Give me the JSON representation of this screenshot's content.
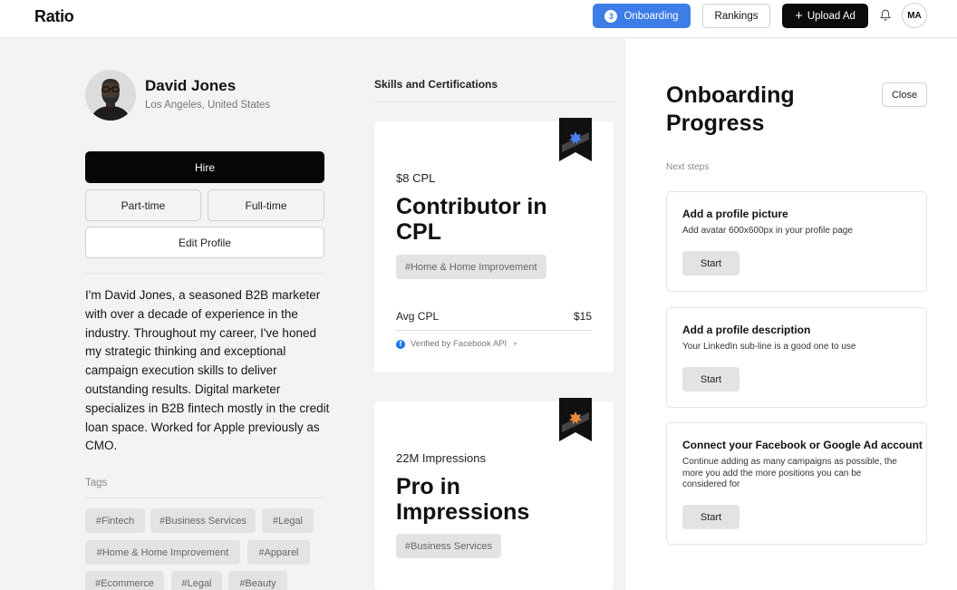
{
  "header": {
    "logo": "Ratio",
    "onboarding": {
      "count": "3",
      "label": "Onboarding"
    },
    "rankings_label": "Rankings",
    "upload_label": "Upload Ad",
    "user_initials": "MA"
  },
  "profile": {
    "name": "David Jones",
    "location": "Los Angeles, United States",
    "hire_label": "Hire",
    "part_time_label": "Part-time",
    "full_time_label": "Full-time",
    "edit_label": "Edit Profile",
    "bio": "I'm David Jones, a seasoned B2B marketer with over a decade of experience in the industry. Throughout my career, I've honed my strategic thinking and exceptional campaign execution skills to deliver outstanding results. Digital marketer specializes in B2B fintech mostly in the credit loan space. Worked for Apple previously as CMO.",
    "tags_label": "Tags",
    "tags": [
      "#Fintech",
      "#Business Services",
      "#Legal",
      "#Home & Home Improvement",
      "#Apparel",
      "#Ecommerce",
      "#Legal",
      "#Beauty"
    ]
  },
  "skills": {
    "title": "Skills and Certifications",
    "cards": [
      {
        "metric": "$8 CPL",
        "title_line1": "Contributor in",
        "title_line2": "CPL",
        "tag": "#Home & Home Improvement",
        "avg_label": "Avg CPL",
        "avg_value": "$15",
        "verified": "Verified by Facebook API",
        "ribbon_color": "#4a7ff0"
      },
      {
        "metric": "22M Impressions",
        "title_line1": "Pro in",
        "title_line2": "Impressions",
        "tag": "#Business Services",
        "ribbon_color": "#e8893a"
      }
    ]
  },
  "onboarding_panel": {
    "title_line1": "Onboarding",
    "title_line2": "Progress",
    "close_label": "Close",
    "next_steps_label": "Next steps",
    "steps": [
      {
        "title": "Add a profile picture",
        "description": "Add avatar 600x600px in your profile page",
        "button": "Start"
      },
      {
        "title": "Add a profile description",
        "description": "Your LinkedIn sub-line is a good one to use",
        "button": "Start"
      },
      {
        "title": "Connect your Facebook or Google Ad account",
        "description_line1": "Continue adding as many campaigns as possible, the",
        "description_line2": "more you add the more positions you can be",
        "description_line3": "considered for",
        "button": "Start"
      }
    ]
  },
  "colors": {
    "accent": "#3d7de8",
    "dark": "#0b0b0b",
    "background": "#f3f3f3",
    "tag_bg": "#e3e3e3"
  }
}
